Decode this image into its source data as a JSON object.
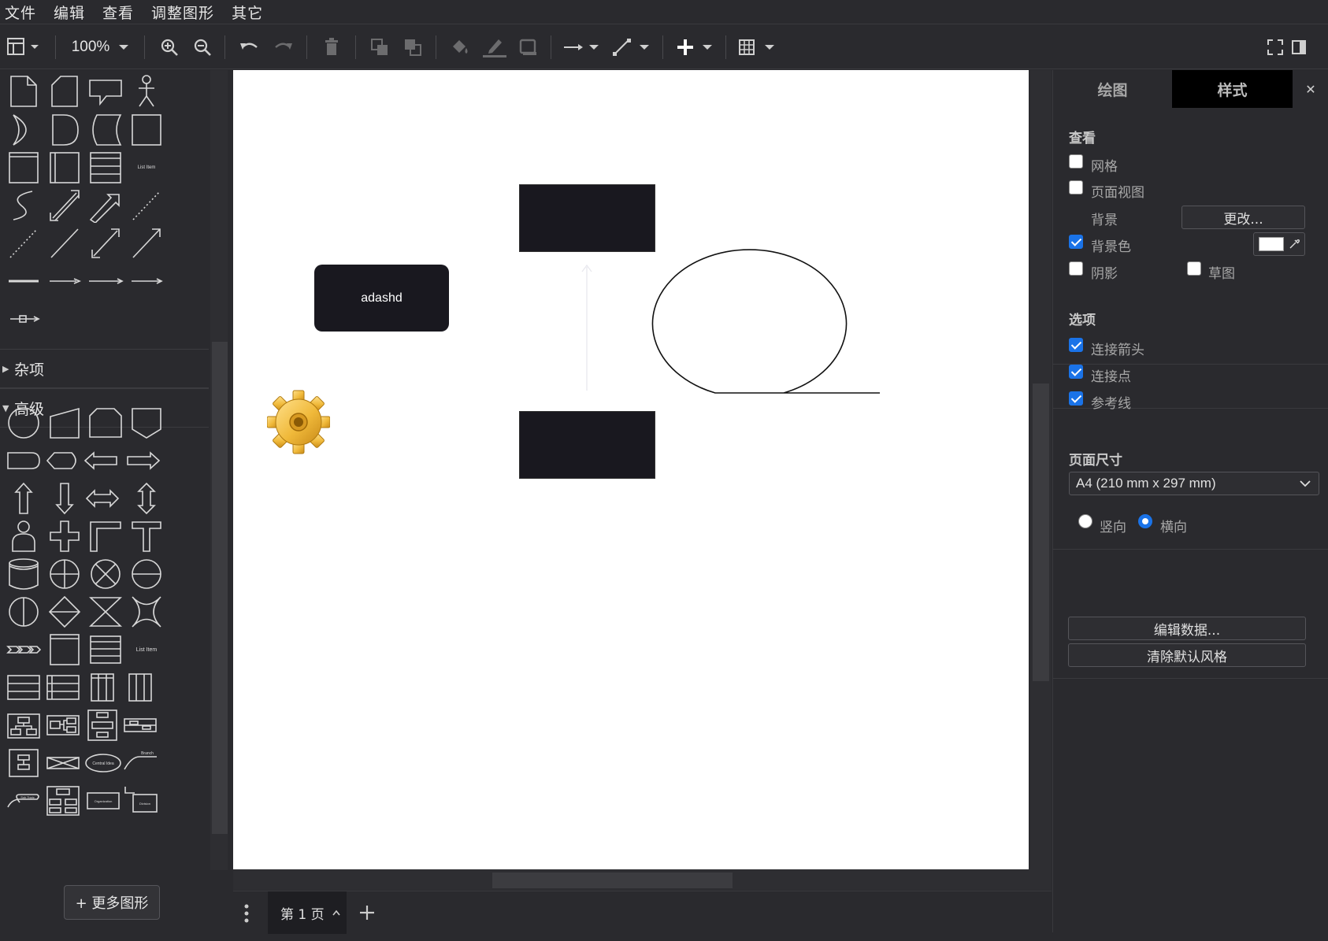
{
  "menu": [
    "文件",
    "编辑",
    "查看",
    "调整图形",
    "其它"
  ],
  "toolbar": {
    "zoom": "100%",
    "icons": [
      "layout-icon",
      "zoom-in-icon",
      "zoom-out-icon",
      "undo-icon",
      "redo-icon",
      "delete-icon",
      "to-front-icon",
      "to-back-icon",
      "fill-color-icon",
      "line-color-icon",
      "shadow-icon",
      "connection-icon",
      "waypoints-icon",
      "insert-icon",
      "table-icon",
      "fullscreen-icon",
      "format-panel-icon"
    ]
  },
  "sidebar": {
    "sections": [
      "杂项",
      "高级"
    ],
    "small_labels": {
      "list": "List",
      "list_item": "List Item",
      "item1": "Item 1",
      "item2": "Item 2",
      "item3": "Item 3",
      "central_idea": "Central Idea",
      "branch": "Branch",
      "sub_topic": "Sub Topic",
      "organization": "Organization",
      "division": "Division"
    },
    "more_shapes": "+ 更多图形"
  },
  "diagram": {
    "rounded_label": "adashd"
  },
  "pagebar": {
    "tab": "第 1 页"
  },
  "panel": {
    "tabs": [
      "绘图",
      "样式"
    ],
    "close": "✕",
    "view_title": "查看",
    "grid": "网格",
    "page_view": "页面视图",
    "background": "背景",
    "change_btn": "更改...",
    "bg_color": "背景色",
    "shadow": "阴影",
    "sketch": "草图",
    "options_title": "选项",
    "conn_arrows": "连接箭头",
    "conn_points": "连接点",
    "guides": "参考线",
    "page_size_title": "页面尺寸",
    "page_size_value": "A4 (210 mm x 297 mm)",
    "portrait": "竖向",
    "landscape": "横向",
    "edit_data": "编辑数据...",
    "clear_style": "清除默认风格"
  },
  "state": {
    "grid": false,
    "page_view": false,
    "bg_color": true,
    "shadow": false,
    "sketch": false,
    "conn_arrows": true,
    "conn_points": true,
    "guides": true,
    "orientation": "landscape",
    "bg_color_swatch": "#ffffff"
  }
}
